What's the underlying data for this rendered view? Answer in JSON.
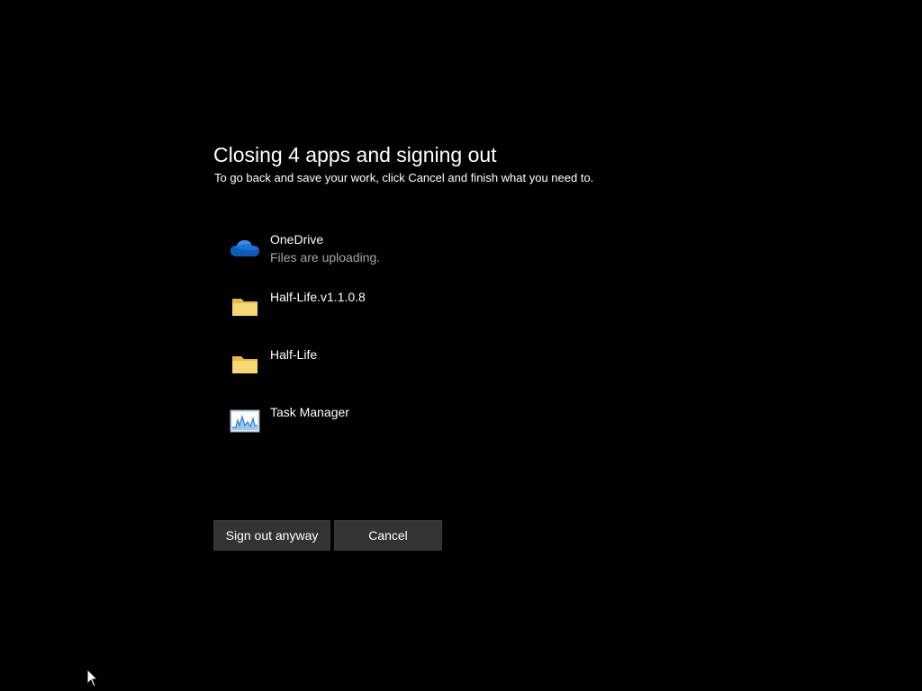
{
  "dialog": {
    "title": "Closing 4 apps and signing out",
    "subtitle": "To go back and save your work, click Cancel and finish what you need to."
  },
  "apps": [
    {
      "name": "OneDrive",
      "status": "Files are uploading.",
      "icon": "onedrive-cloud-icon"
    },
    {
      "name": "Half-Life.v1.1.0.8",
      "status": "",
      "icon": "folder-icon"
    },
    {
      "name": "Half-Life",
      "status": "",
      "icon": "folder-icon"
    },
    {
      "name": "Task Manager",
      "status": "",
      "icon": "task-manager-icon"
    }
  ],
  "buttons": {
    "sign_out_label": "Sign out anyway",
    "cancel_label": "Cancel"
  },
  "colors": {
    "background": "#000000",
    "button_bg": "#333333",
    "status_text": "#a6a6a6",
    "onedrive_blue": "#1a73d6",
    "folder_yellow": "#f8d775"
  }
}
